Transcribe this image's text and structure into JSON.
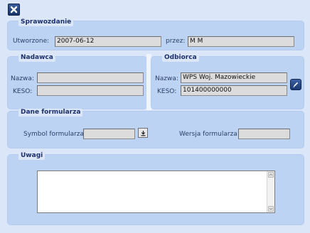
{
  "toolbar": {
    "close_icon": "close-x-icon"
  },
  "sprawozdanie": {
    "legend": "Sprawozdanie",
    "created_label": "Utworzone:",
    "created_value": "2007-06-12",
    "by_label": "przez:",
    "by_value": "M M"
  },
  "nadawca": {
    "legend": "Nadawca",
    "name_label": "Nazwa:",
    "name_value": "",
    "keso_label": "KESO:",
    "keso_value": ""
  },
  "odbiorca": {
    "legend": "Odbiorca",
    "name_label": "Nazwa:",
    "name_value": "WPS Woj. Mazowieckie",
    "keso_label": "KESO:",
    "keso_value": "101400000000",
    "edit_icon": "pencil-edit-icon"
  },
  "dane": {
    "legend": "Dane formularza",
    "symbol_label": "Symbol formularza:",
    "symbol_value": "",
    "version_label": "Wersja formularza:",
    "version_value": "",
    "download_icon": "download-arrow-icon"
  },
  "uwagi": {
    "legend": "Uwagi",
    "text": ""
  }
}
